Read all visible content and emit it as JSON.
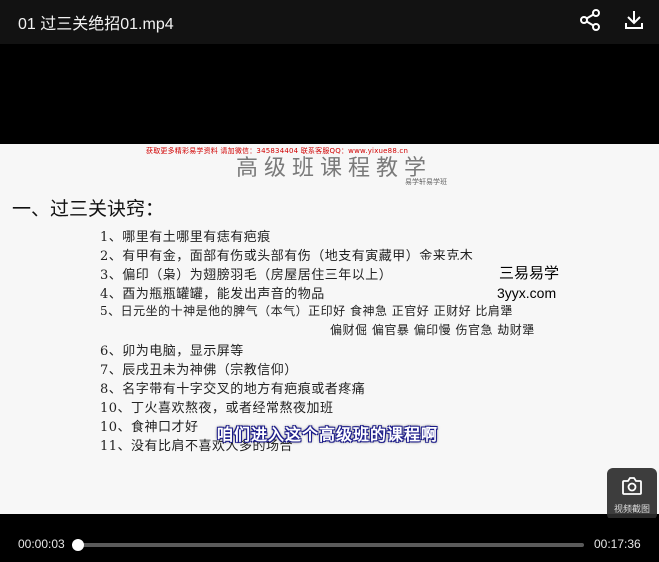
{
  "window": {
    "title": "01 过三关绝招01.mp4"
  },
  "toolbar": {
    "share_icon": "share-icon",
    "download_icon": "download-icon"
  },
  "slide": {
    "watermark_top": "获取更多精彩易学资料 请加微信：345834404 联系客服QQ：www.yixue88.cn",
    "board_title": "高级班课程教学",
    "board_subtitle": "易学轩易学班",
    "heading": "一、过三关诀窍：",
    "lines": [
      "1、哪里有土哪里有痣有疤痕",
      "2、有甲有金，面部有伤或头部有伤（地支有寅藏甲）金来克木",
      "3、偏印（枭）为翅膀羽毛（房屋居住三年以上）",
      "4、酉为瓶瓶罐罐，能发出声音的物品",
      "5、日元坐的十神是他的脾气（本气）正印好  食神急  正官好  正财好  比肩犟",
      "偏财倔  偏官暴  偏印慢  伤官急  劫财犟",
      "6、卯为电脑，显示屏等",
      "7、辰戌丑未为神佛（宗教信仰）",
      "8、名字带有十字交叉的地方有疤痕或者疼痛",
      "10、丁火喜欢熬夜，或者经常熬夜加班",
      "10、食神口才好",
      "11、没有比肩不喜欢人多的场合"
    ],
    "overlay_brand": "三易易学",
    "overlay_site": "3yyx.com"
  },
  "player": {
    "subtitle": "咱们进入这个高级班的课程啊",
    "screenshot_label": "视频截图",
    "current_time": "00:00:03",
    "total_time": "00:17:36",
    "progress_fraction": 0.003
  }
}
